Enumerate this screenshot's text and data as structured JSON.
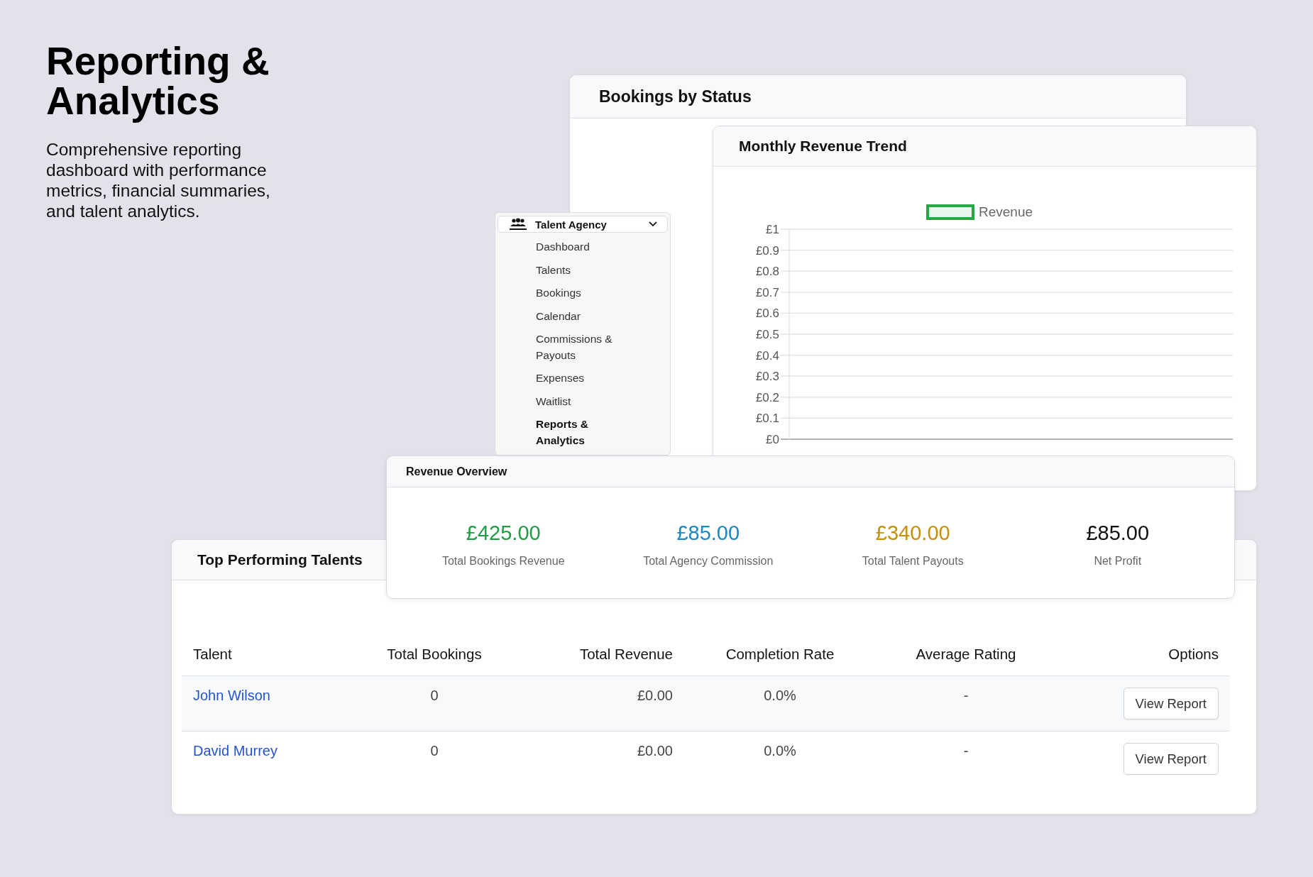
{
  "intro": {
    "title": "Reporting & Analytics",
    "description": "Comprehensive reporting dashboard with performance metrics, financial summaries, and talent analytics."
  },
  "bookings_by_status": {
    "title": "Bookings by Status"
  },
  "sidebar": {
    "header": "Talent Agency",
    "expanded": true,
    "items": [
      {
        "label": "Dashboard",
        "selected": false
      },
      {
        "label": "Talents",
        "selected": false
      },
      {
        "label": "Bookings",
        "selected": false
      },
      {
        "label": "Calendar",
        "selected": false
      },
      {
        "label": "Commissions & Payouts",
        "selected": false
      },
      {
        "label": "Expenses",
        "selected": false
      },
      {
        "label": "Waitlist",
        "selected": false
      },
      {
        "label": "Reports & Analytics",
        "selected": true
      }
    ]
  },
  "monthly_revenue_trend": {
    "title": "Monthly Revenue Trend",
    "chart_data": {
      "type": "line",
      "grid": true,
      "series": [
        {
          "name": "Revenue",
          "color": "#28a745"
        }
      ],
      "ylim": [
        0,
        1
      ],
      "yticks": [
        {
          "value": 0,
          "label": "£0"
        },
        {
          "value": 0.1,
          "label": "£0.1"
        },
        {
          "value": 0.2,
          "label": "£0.2"
        },
        {
          "value": 0.3,
          "label": "£0.3"
        },
        {
          "value": 0.4,
          "label": "£0.4"
        },
        {
          "value": 0.5,
          "label": "£0.5"
        },
        {
          "value": 0.6,
          "label": "£0.6"
        },
        {
          "value": 0.7,
          "label": "£0.7"
        },
        {
          "value": 0.8,
          "label": "£0.8"
        },
        {
          "value": 0.9,
          "label": "£0.9"
        },
        {
          "value": 1,
          "label": "£1"
        }
      ]
    }
  },
  "revenue_overview": {
    "title": "Revenue Overview",
    "stats": [
      {
        "value": "£425.00",
        "label": "Total Bookings Revenue",
        "color": "#1e9e43"
      },
      {
        "value": "£85.00",
        "label": "Total Agency Commission",
        "color": "#1a87c9"
      },
      {
        "value": "£340.00",
        "label": "Total Talent Payouts",
        "color": "#c8900a"
      },
      {
        "value": "£85.00",
        "label": "Net Profit",
        "color": "#111111"
      }
    ]
  },
  "top_performing_talents": {
    "title": "Top Performing Talents",
    "columns": [
      "Talent",
      "Total Bookings",
      "Total Revenue",
      "Completion Rate",
      "Average Rating",
      "Options"
    ],
    "rows": [
      {
        "talent": "John Wilson",
        "total_bookings": "0",
        "total_revenue": "£0.00",
        "completion_rate": "0.0%",
        "average_rating": "-",
        "action": "View Report"
      },
      {
        "talent": "David Murrey",
        "total_bookings": "0",
        "total_revenue": "£0.00",
        "completion_rate": "0.0%",
        "average_rating": "-",
        "action": "View Report"
      }
    ]
  }
}
